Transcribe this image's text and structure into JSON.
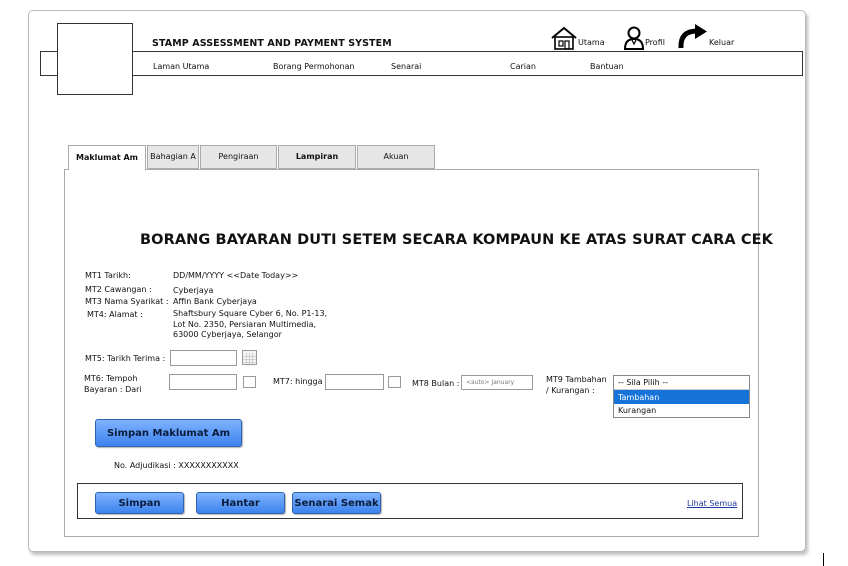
{
  "header": {
    "system_title": "STAMP ASSESSMENT AND PAYMENT SYSTEM",
    "icons": [
      {
        "icon": "home-icon",
        "label": "Utama"
      },
      {
        "icon": "profile-icon",
        "label": "Profil"
      },
      {
        "icon": "logout-arrow-icon",
        "label": "Keluar"
      }
    ]
  },
  "nav": {
    "items": [
      "Laman Utama",
      "Borang Permohonan",
      "Senarai",
      "Carian",
      "Bantuan"
    ]
  },
  "tabs": [
    "Maklumat Am",
    "Bahagian A",
    "Pengiraan",
    "Lampiran",
    "Akuan"
  ],
  "form": {
    "title": "BORANG BAYARAN DUTI SETEM SECARA KOMPAUN KE ATAS SURAT CARA CEK",
    "mt1_label": "MT1 Tarikh:",
    "mt1_value": "DD/MM/YYYY <<Date Today>>",
    "mt2_label": "MT2 Cawangan :",
    "mt2_value": "Cyberjaya",
    "mt3_label": "MT3 Nama Syarikat :",
    "mt3_value": "Affin Bank Cyberjaya",
    "mt4_label": "MT4: Alamat :",
    "mt4_lines": [
      "Shaftsbury Square Cyber 6, No. P1-13,",
      "Lot No. 2350, Persiaran Multimedia,",
      "63000 Cyberjaya, Selangor"
    ],
    "mt5_label": "MT5: Tarikh Terima :",
    "mt6_label_1": "MT6: Tempoh",
    "mt6_label_2": "Bayaran :  Dari",
    "mt7_label": "MT7:  hingga",
    "mt8_label": "MT8 Bulan :",
    "mt8_placeholder": "<auto> January",
    "mt9_label_1": "MT9 Tambahan",
    "mt9_label_2": "/ Kurangan :",
    "mt9_options": [
      "-- Sila Pilih --",
      "Tambahan",
      "Kurangan"
    ],
    "mt9_highlighted": "Tambahan",
    "save_general_button": "Simpan Maklumat Am",
    "adjudication": "No. Adjudikasi : XXXXXXXXXXX"
  },
  "footer": {
    "buttons": [
      "Simpan",
      "Hantar",
      "Senarai Semak"
    ],
    "view_all_link": "Lihat Semua"
  }
}
